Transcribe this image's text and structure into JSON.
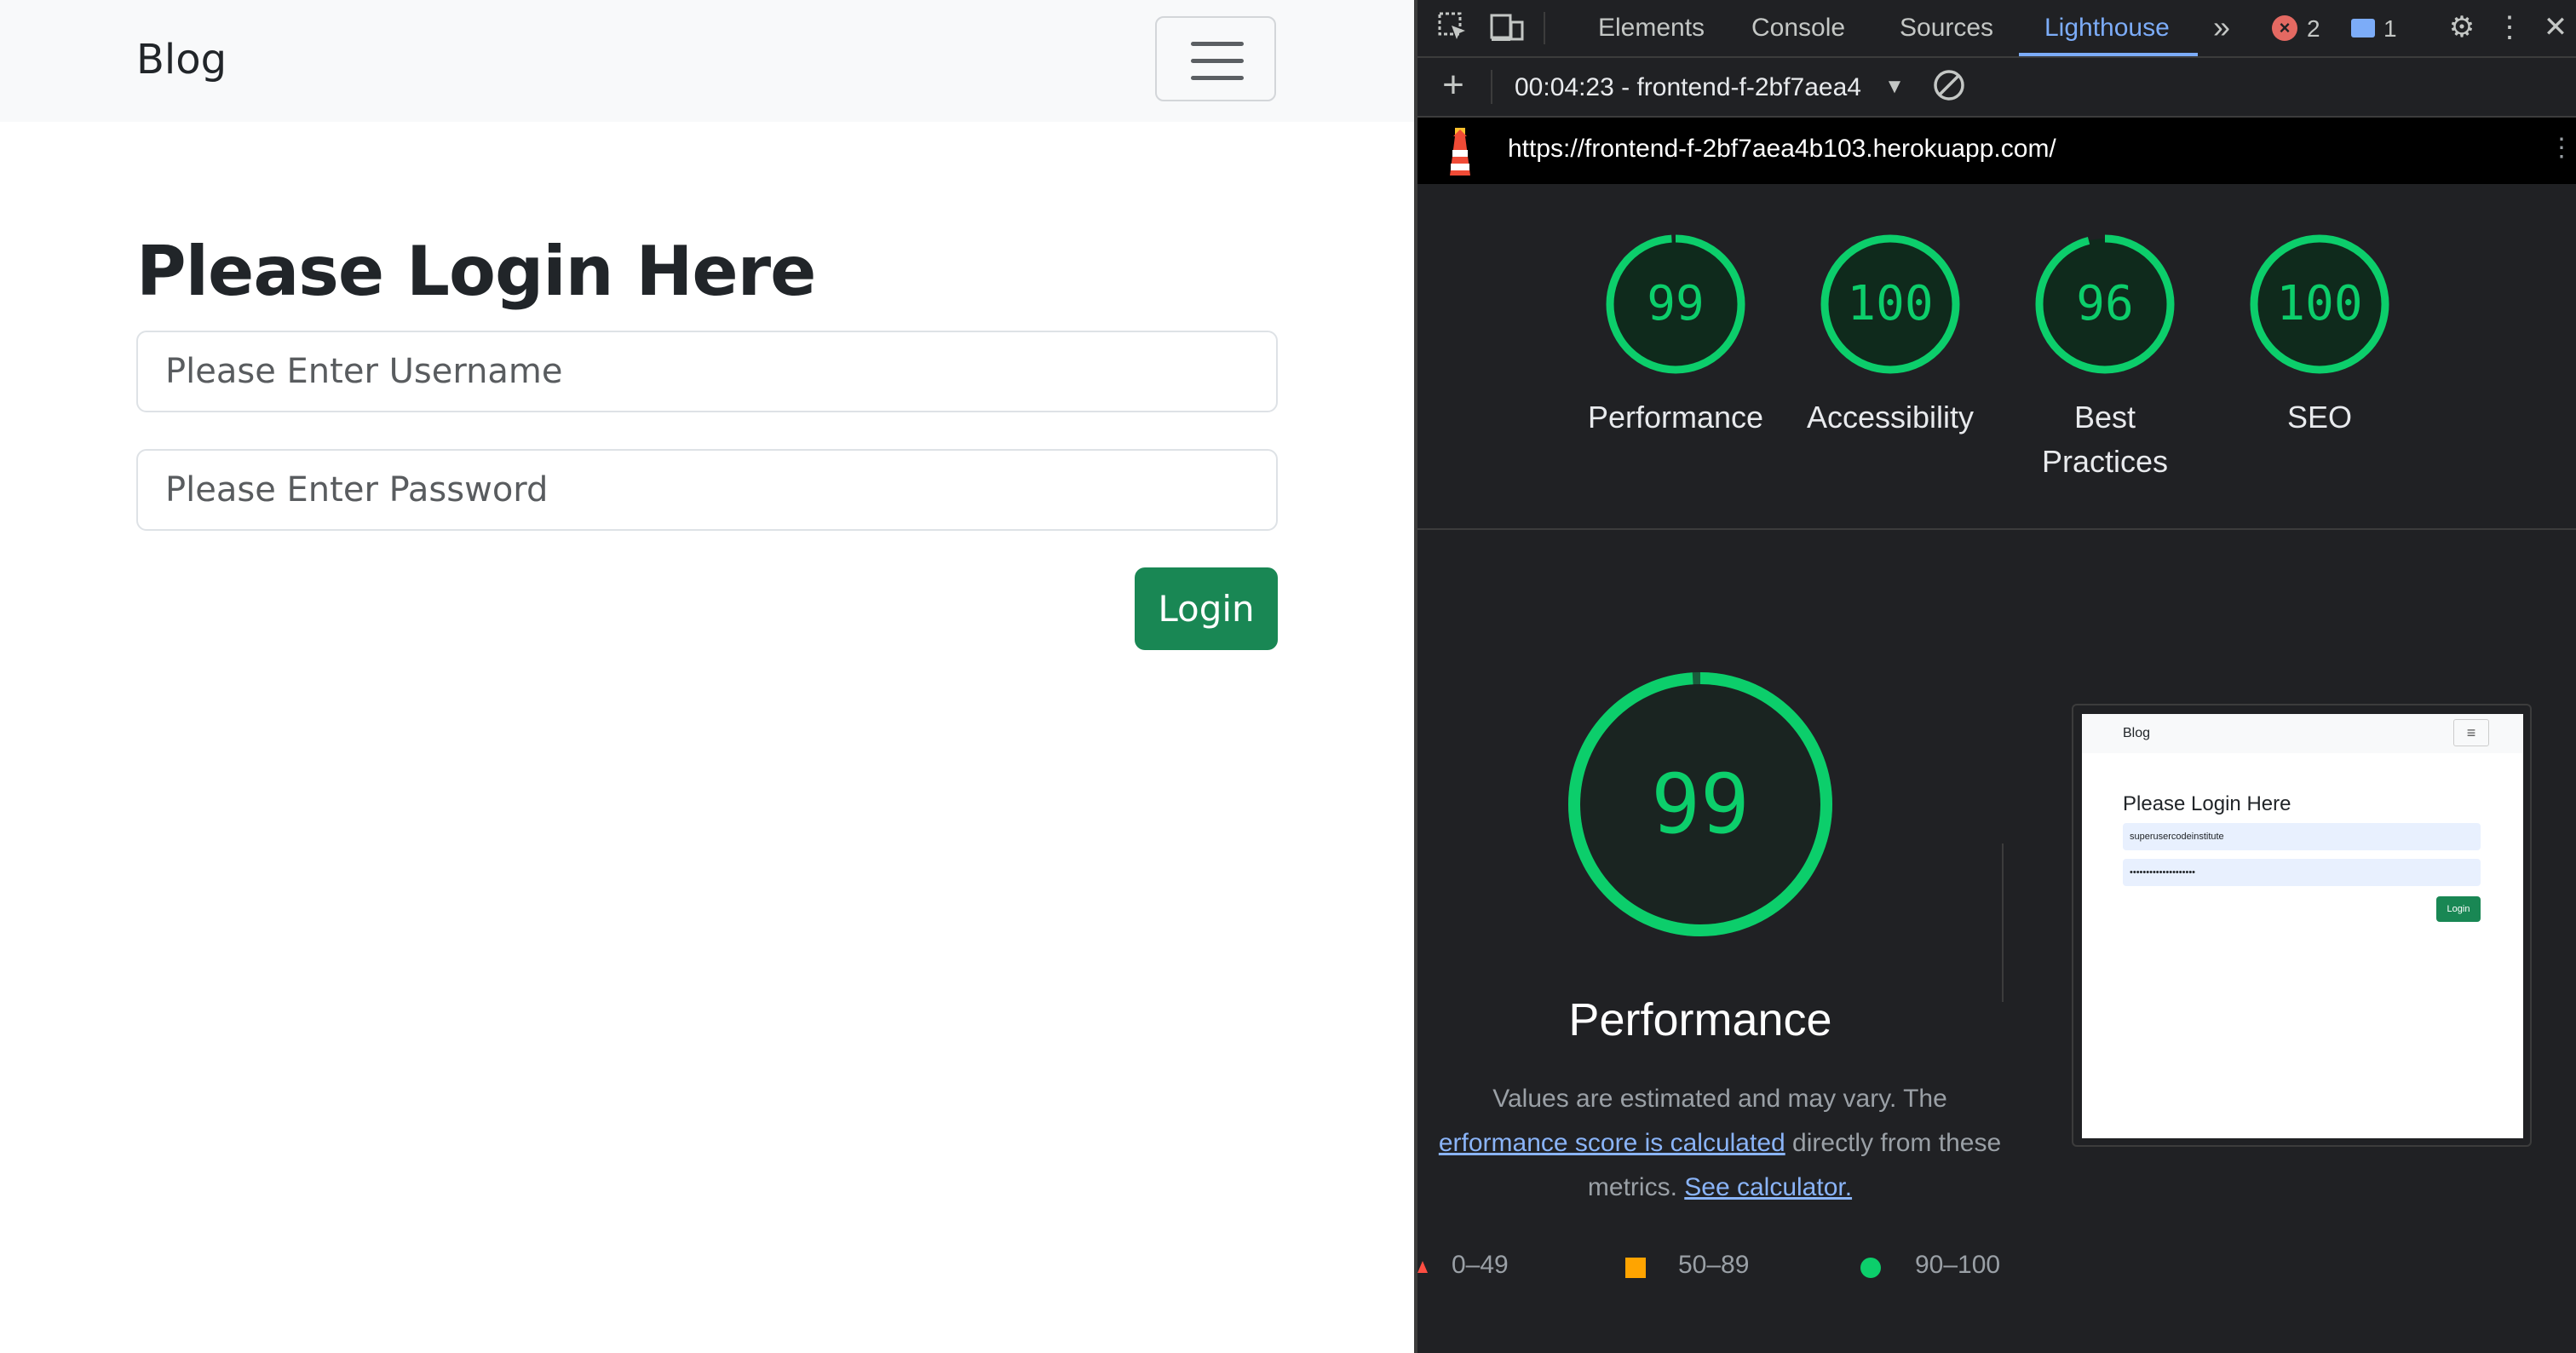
{
  "page": {
    "brand": "Blog",
    "heading": "Please Login Here",
    "username_placeholder": "Please Enter Username",
    "password_placeholder": "Please Enter Password",
    "login_label": "Login"
  },
  "devtools": {
    "tabs": [
      "Elements",
      "Console",
      "Sources",
      "Lighthouse"
    ],
    "active_tab": "Lighthouse",
    "error_count": "2",
    "message_count": "1",
    "session_label": "00:04:23 - frontend-f-2bf7aea4",
    "url": "https://frontend-f-2bf7aea4b103.herokuapp.com/",
    "scores": [
      {
        "label": "Performance",
        "value": "99",
        "score": 0.99
      },
      {
        "label": "Accessibility",
        "value": "100",
        "score": 1.0
      },
      {
        "label": "Best Practices",
        "value": "96",
        "score": 0.96
      },
      {
        "label": "SEO",
        "value": "100",
        "score": 1.0
      }
    ],
    "detail": {
      "score": "99",
      "title": "Performance",
      "desc_1": "Values are estimated and may vary. The",
      "desc_link_1": "erformance score is calculated",
      "desc_2": "directly from these",
      "desc_3": "metrics.",
      "desc_link_2": "See calculator."
    },
    "thumbnail": {
      "brand": "Blog",
      "heading": "Please Login Here",
      "username_value": "superusercodeinstitute",
      "password_value": "••••••••••••••••••••",
      "login_label": "Login"
    },
    "legend": [
      {
        "range": "0–49",
        "color": "#ff4e42"
      },
      {
        "range": "50–89",
        "color": "#ffa400"
      },
      {
        "range": "90–100",
        "color": "#0cce6b"
      }
    ]
  },
  "colors": {
    "pass": "#0cce6b",
    "bootstrap_success": "#198754",
    "devtools_bg": "#202124",
    "link": "#8ab4f8"
  }
}
